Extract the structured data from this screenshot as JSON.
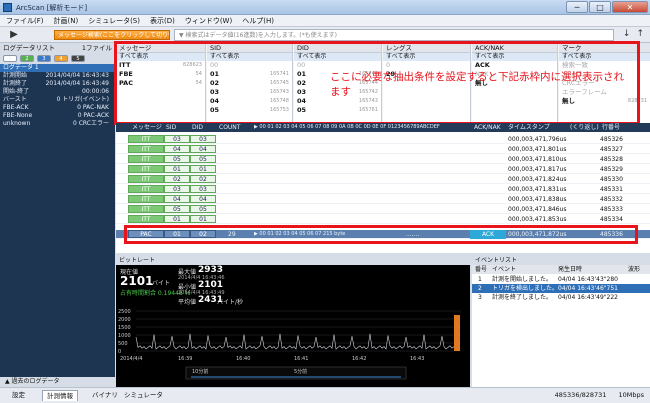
{
  "window": {
    "title": "ArcScan [解析モード]",
    "controls": [
      "─",
      "□",
      "✕"
    ]
  },
  "menu": [
    "ファイル(F)",
    "計画(N)",
    "シミュレータ(S)",
    "表示(D)",
    "ウィンドウ(W)",
    "ヘルプ(H)"
  ],
  "toolbar": {
    "play_icon": "play-icon",
    "message_filter": "メッセージ検索(ここをクリックして切り替え)",
    "search_placeholder": "▼ 検索式はデータ値(16進数)を入力します。(*も使えます)"
  },
  "left_panel": {
    "title": "ログデータリスト",
    "count": "1ファイル",
    "tabs": [
      "1",
      "2",
      "3",
      "4",
      "5"
    ],
    "items": [
      {
        "label": "ログデータ 1",
        "value": ""
      },
      {
        "label": "計測開始",
        "value": "2014/04/04 16:43:43"
      },
      {
        "label": "計測終了",
        "value": "2014/04/04 16:43:49"
      },
      {
        "label": "開始-終了",
        "value": "00:00:06"
      },
      {
        "label": "バースト",
        "value": "0  トリガ(イベント)"
      },
      {
        "label": "FBE-ACK",
        "value": "0  PAC-NAK"
      },
      {
        "label": "FBE-None",
        "value": "0  PAC-ACK"
      },
      {
        "label": "unknown",
        "value": "0  CRCエラー"
      }
    ],
    "footer": "▲ 過去のログデータ"
  },
  "filters": {
    "columns": [
      {
        "title": "メッセージ",
        "all": "すべて表示",
        "rows": [
          {
            "v": "ITT",
            "n": "828623"
          },
          {
            "v": "FBE",
            "n": "54"
          },
          {
            "v": "PAC",
            "n": "54"
          }
        ]
      },
      {
        "title": "SID",
        "all": "すべて表示",
        "rows": [
          {
            "v": "00",
            "n": ""
          },
          {
            "v": "01",
            "n": "165741"
          },
          {
            "v": "02",
            "n": "165745"
          },
          {
            "v": "03",
            "n": "165743"
          },
          {
            "v": "04",
            "n": "165748"
          },
          {
            "v": "05",
            "n": "165753"
          }
        ]
      },
      {
        "title": "DID",
        "all": "すべて表示",
        "rows": [
          {
            "v": "00",
            "n": ""
          },
          {
            "v": "01",
            "n": "165741"
          },
          {
            "v": "02",
            "n": "165744"
          },
          {
            "v": "03",
            "n": "165742"
          },
          {
            "v": "04",
            "n": "165743"
          },
          {
            "v": "05",
            "n": "165761"
          }
        ]
      },
      {
        "title": "レングス",
        "all": "すべて表示",
        "rows": [
          {
            "v": "0",
            "n": ""
          },
          {
            "v": "29",
            "n": ""
          }
        ]
      },
      {
        "title": "ACK/NAK",
        "all": "すべて表示",
        "rows": [
          {
            "v": "ACK",
            "n": ""
          },
          {
            "v": "NAK",
            "n": ""
          },
          {
            "v": "無し",
            "n": ""
          }
        ]
      },
      {
        "title": "マーク",
        "all": "すべて表示",
        "rows": [
          {
            "v": "検索一致",
            "n": ""
          },
          {
            "v": "トリガ",
            "n": ""
          },
          {
            "v": "CRCエラー",
            "n": ""
          },
          {
            "v": "エラーフレーム",
            "n": ""
          },
          {
            "v": "無し",
            "n": "828731"
          }
        ]
      }
    ],
    "annotation": "ここに必要な抽出条件を設定すると下記赤枠内に選択表示されます"
  },
  "grid": {
    "headers": {
      "msg": "メッセージ",
      "sid": "SID",
      "did": "DID",
      "count": "COUNT",
      "data": "▶ 00 01 02 03 04 05 06 07 08 09 0A 0B 0C 0D 0E 0F  0123456789ABCDEF",
      "ack": "ACK/NAK",
      "ts": "タイムスタンプ",
      "diff": "(くり返し)",
      "no": "行番号"
    },
    "rows": [
      {
        "msg": "ITT",
        "sid": "03",
        "did": "03",
        "ts": "000,003,471,796us",
        "no": "485326"
      },
      {
        "msg": "ITT",
        "sid": "04",
        "did": "04",
        "ts": "000,003,471,801us",
        "no": "485327"
      },
      {
        "msg": "ITT",
        "sid": "05",
        "did": "05",
        "ts": "000,003,471,810us",
        "no": "485328"
      },
      {
        "msg": "ITT",
        "sid": "01",
        "did": "01",
        "ts": "000,003,471,817us",
        "no": "485329"
      },
      {
        "msg": "ITT",
        "sid": "02",
        "did": "02",
        "ts": "000,003,471,824us",
        "no": "485330"
      },
      {
        "msg": "ITT",
        "sid": "03",
        "did": "03",
        "ts": "000,003,471,831us",
        "no": "485331"
      },
      {
        "msg": "ITT",
        "sid": "04",
        "did": "04",
        "ts": "000,003,471,838us",
        "no": "485332"
      },
      {
        "msg": "ITT",
        "sid": "05",
        "did": "05",
        "ts": "000,003,471,846us",
        "no": "485333"
      },
      {
        "msg": "ITT",
        "sid": "01",
        "did": "01",
        "ts": "000,003,471,853us",
        "no": "485334"
      }
    ],
    "pac_row": {
      "msg": "PAC",
      "sid": "01",
      "did": "02",
      "count": "29",
      "data": "▶ 00 01 02 03 04 05 06 07    215 byte",
      "dots": ".......",
      "ack": "ACK",
      "ts": "000,003,471,872us",
      "no": "485336"
    }
  },
  "bitrate": {
    "title": "ビットレート",
    "current_label": "現在値",
    "current_value": "2101",
    "unit": "バイト",
    "percent": "占有時間割合 0.19448 %",
    "max_label": "最大値",
    "max_value": "2933",
    "min_label": "最小値",
    "min_value": "2101",
    "avg_label": "平均値",
    "avg_value": "2431",
    "avg_unit": "バイト/秒",
    "max_time": "2014/4/4 16:43:46",
    "min_time": "2014/4/4 16:43:49",
    "y_ticks": [
      "2500",
      "2000",
      "1500",
      "1000",
      "500",
      "0"
    ],
    "x_ticks": [
      "2014/4/4",
      "16:39",
      "16:40",
      "16:41",
      "16:42",
      "16:43"
    ],
    "range_labels": [
      "10分前",
      "5分前"
    ]
  },
  "events": {
    "title": "イベントリスト",
    "headers": [
      "番号",
      "イベント",
      "発生日時",
      "波形"
    ],
    "rows": [
      {
        "no": "1",
        "ev": "計測を開始しました。",
        "at": "04/04 16:43'43\"280"
      },
      {
        "no": "2",
        "ev": "トリガを検出しました。",
        "at": "04/04 16:43'46\"751"
      },
      {
        "no": "3",
        "ev": "計測を終了しました。",
        "at": "04/04 16:43'49\"222"
      }
    ]
  },
  "status": {
    "tabs": [
      "設定",
      "計測情報",
      "バイナリ",
      "シミュレータ"
    ],
    "position": "485336/828731",
    "rate": "10Mbps"
  }
}
